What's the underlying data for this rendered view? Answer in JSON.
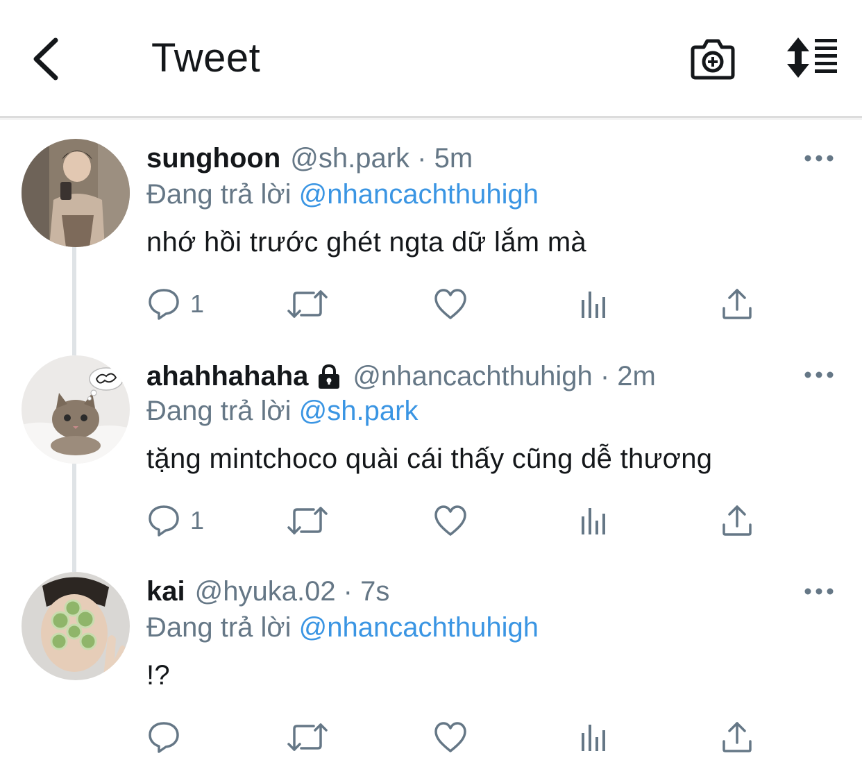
{
  "header": {
    "title": "Tweet",
    "back_icon": "chevron-left-icon",
    "camera_icon": "camera-plus-icon",
    "sort_icon": "sort-list-icon"
  },
  "colors": {
    "accent": "#3a95e3",
    "secondary_text": "#657786",
    "primary_text": "#14171a",
    "thread_line": "#dfe3e6"
  },
  "tweets": [
    {
      "name": "sunghoon",
      "handle": "@sh.park · 5m",
      "reply_prefix": "Đang trả lời",
      "reply_to": "@nhancachthuhigh",
      "text": "nhớ hồi trước ghét ngta dữ lắm mà",
      "reply_count": "1",
      "locked": false
    },
    {
      "name": "ahahhahaha",
      "handle": "@nhancachthuhigh · 2m",
      "reply_prefix": "Đang trả lời",
      "reply_to": "@sh.park",
      "text": "tặng mintchoco quài cái thấy cũng dễ thương",
      "reply_count": "1",
      "locked": true
    },
    {
      "name": "kai",
      "handle": "@hyuka.02 · 7s",
      "reply_prefix": "Đang trả lời",
      "reply_to": "@nhancachthuhigh",
      "text": "!?",
      "reply_count": "",
      "locked": false
    }
  ]
}
